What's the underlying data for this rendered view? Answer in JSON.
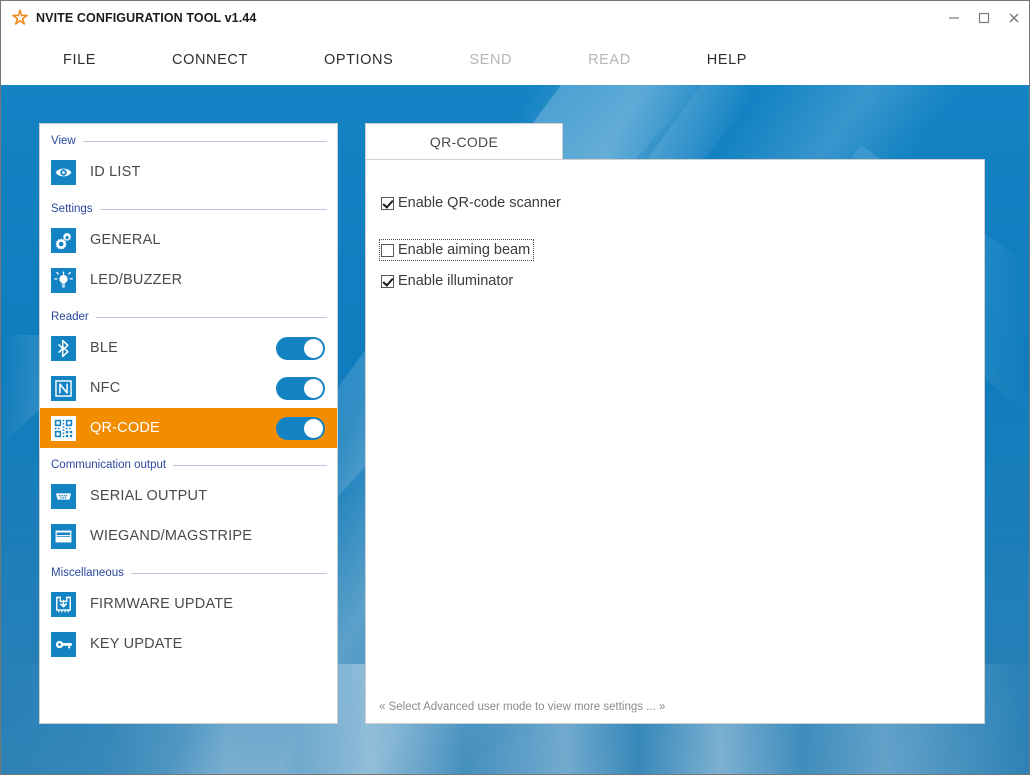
{
  "window": {
    "title": "NVITE CONFIGURATION TOOL v1.44",
    "logo_icon": "orange-star-icon",
    "controls": [
      {
        "name": "minimize",
        "label": "–"
      },
      {
        "name": "maximize",
        "label": "☐"
      },
      {
        "name": "close",
        "label": "✕"
      }
    ]
  },
  "menubar": {
    "items": [
      {
        "label": "FILE",
        "disabled": false
      },
      {
        "label": "CONNECT",
        "disabled": false
      },
      {
        "label": "OPTIONS",
        "disabled": false
      },
      {
        "label": "SEND",
        "disabled": true
      },
      {
        "label": "READ",
        "disabled": true
      },
      {
        "label": "HELP",
        "disabled": false
      }
    ]
  },
  "sidebar": {
    "sections": [
      {
        "title": "View",
        "items": [
          {
            "label": "ID LIST",
            "icon": "eye-icon",
            "toggle": null,
            "active": false
          }
        ]
      },
      {
        "title": "Settings",
        "items": [
          {
            "label": "GENERAL",
            "icon": "gears-icon",
            "toggle": null,
            "active": false
          },
          {
            "label": "LED/BUZZER",
            "icon": "lightbulb-icon",
            "toggle": null,
            "active": false
          }
        ]
      },
      {
        "title": "Reader",
        "items": [
          {
            "label": "BLE",
            "icon": "bluetooth-icon",
            "toggle": "on",
            "active": false
          },
          {
            "label": "NFC",
            "icon": "nfc-icon",
            "toggle": "on",
            "active": false
          },
          {
            "label": "QR-CODE",
            "icon": "qrcode-icon",
            "toggle": "on",
            "active": true
          }
        ]
      },
      {
        "title": "Communication output",
        "items": [
          {
            "label": "SERIAL OUTPUT",
            "icon": "serial-port-icon",
            "toggle": null,
            "active": false
          },
          {
            "label": "WIEGAND/MAGSTRIPE",
            "icon": "magstripe-card-icon",
            "toggle": null,
            "active": false
          }
        ]
      },
      {
        "title": "Miscellaneous",
        "items": [
          {
            "label": "FIRMWARE UPDATE",
            "icon": "chip-download-icon",
            "toggle": null,
            "active": false
          },
          {
            "label": "KEY UPDATE",
            "icon": "key-icon",
            "toggle": null,
            "active": false
          }
        ]
      }
    ]
  },
  "main": {
    "tab": {
      "label": "QR-CODE",
      "selected": true
    },
    "checkboxes": [
      {
        "label": "Enable QR-code scanner",
        "checked": true,
        "focused": false,
        "spacing": "none"
      },
      {
        "label": "Enable aiming beam",
        "checked": false,
        "focused": true,
        "spacing": "large"
      },
      {
        "label": "Enable illuminator",
        "checked": true,
        "focused": false,
        "spacing": "small"
      }
    ],
    "footer_note": "« Select Advanced user mode to view more settings ... »"
  },
  "colors": {
    "accent_blue": "#1383c4",
    "highlight_orange": "#f28c00",
    "section_label": "#2a48a0",
    "logo_orange": "#f08a1e"
  }
}
